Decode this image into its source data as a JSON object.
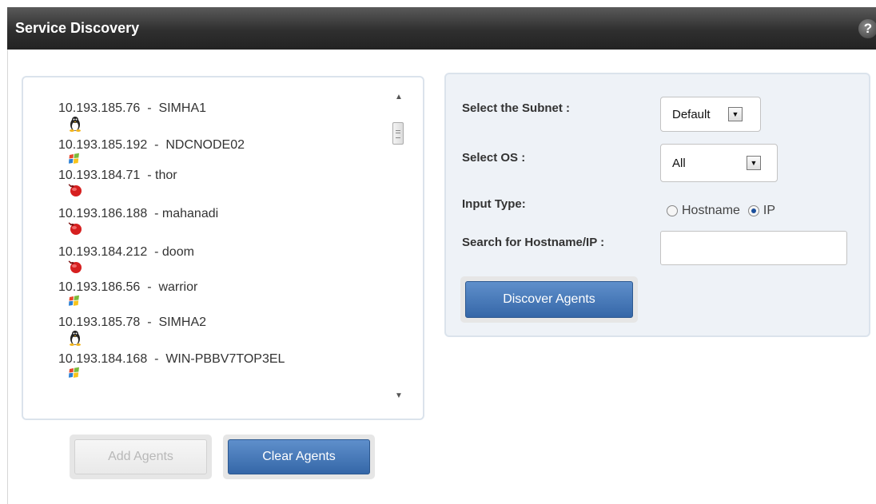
{
  "title": "Service Discovery",
  "help_icon": "?",
  "agents": [
    {
      "os": "linux",
      "ip": "10.193.185.76",
      "sep": "  -  ",
      "name": "SIMHA1"
    },
    {
      "os": "windows",
      "ip": "10.193.185.192",
      "sep": "  -  ",
      "name": "NDCNODE02"
    },
    {
      "os": "solaris",
      "ip": "10.193.184.71",
      "sep": "  - ",
      "name": "thor"
    },
    {
      "os": "solaris",
      "ip": "10.193.186.188",
      "sep": "  - ",
      "name": "mahanadi"
    },
    {
      "os": "solaris",
      "ip": "10.193.184.212",
      "sep": "  - ",
      "name": "doom"
    },
    {
      "os": "windows",
      "ip": "10.193.186.56",
      "sep": "  -  ",
      "name": "warrior"
    },
    {
      "os": "linux",
      "ip": "10.193.185.78",
      "sep": "  -  ",
      "name": "SIMHA2"
    },
    {
      "os": "windows",
      "ip": "10.193.184.168",
      "sep": "  -  ",
      "name": "WIN-PBBV7TOP3EL"
    }
  ],
  "buttons": {
    "add_agents": "Add Agents",
    "clear_agents": "Clear Agents",
    "discover_agents": "Discover Agents"
  },
  "form": {
    "subnet_label": "Select the Subnet :",
    "subnet_value": "Default",
    "os_label": "Select OS :",
    "os_value": "All",
    "input_type_label": "Input Type:",
    "radio_hostname": "Hostname",
    "radio_ip": "IP",
    "selected_input_type": "IP",
    "search_label": "Search for Hostname/IP :",
    "search_value": ""
  },
  "colors": {
    "titlebar": "#2f2f2f",
    "primary_button": "#3567a8",
    "panel_bg": "#eef2f7"
  }
}
